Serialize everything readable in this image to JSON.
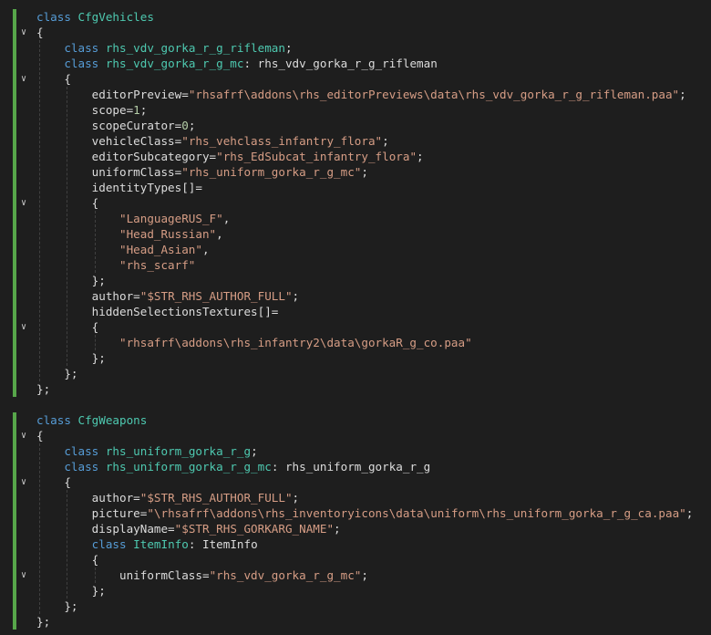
{
  "editor": {
    "language": "C++ (Arma config)",
    "lines": [
      [
        {
          "t": "kw",
          "v": "class "
        },
        {
          "t": "cls",
          "v": "CfgVehicles"
        }
      ],
      [
        {
          "t": "plain",
          "v": "{"
        }
      ],
      [
        {
          "t": "kw",
          "v": "    class "
        },
        {
          "t": "cls",
          "v": "rhs_vdv_gorka_r_g_rifleman"
        },
        {
          "t": "plain",
          "v": ";"
        }
      ],
      [
        {
          "t": "kw",
          "v": "    class "
        },
        {
          "t": "cls",
          "v": "rhs_vdv_gorka_r_g_mc"
        },
        {
          "t": "plain",
          "v": ": rhs_vdv_gorka_r_g_rifleman"
        }
      ],
      [
        {
          "t": "plain",
          "v": "    {"
        }
      ],
      [
        {
          "t": "plain",
          "v": "        editorPreview="
        },
        {
          "t": "str",
          "v": "\"rhsafrf\\addons\\rhs_editorPreviews\\data\\rhs_vdv_gorka_r_g_rifleman.paa\""
        },
        {
          "t": "plain",
          "v": ";"
        }
      ],
      [
        {
          "t": "plain",
          "v": "        scope="
        },
        {
          "t": "num",
          "v": "1"
        },
        {
          "t": "plain",
          "v": ";"
        }
      ],
      [
        {
          "t": "plain",
          "v": "        scopeCurator="
        },
        {
          "t": "num",
          "v": "0"
        },
        {
          "t": "plain",
          "v": ";"
        }
      ],
      [
        {
          "t": "plain",
          "v": "        vehicleClass="
        },
        {
          "t": "str",
          "v": "\"rhs_vehclass_infantry_flora\""
        },
        {
          "t": "plain",
          "v": ";"
        }
      ],
      [
        {
          "t": "plain",
          "v": "        editorSubcategory="
        },
        {
          "t": "str",
          "v": "\"rhs_EdSubcat_infantry_flora\""
        },
        {
          "t": "plain",
          "v": ";"
        }
      ],
      [
        {
          "t": "plain",
          "v": "        uniformClass="
        },
        {
          "t": "str",
          "v": "\"rhs_uniform_gorka_r_g_mc\""
        },
        {
          "t": "plain",
          "v": ";"
        }
      ],
      [
        {
          "t": "plain",
          "v": "        identityTypes[]="
        }
      ],
      [
        {
          "t": "plain",
          "v": "        {"
        }
      ],
      [
        {
          "t": "str",
          "v": "            \"LanguageRUS_F\""
        },
        {
          "t": "plain",
          "v": ","
        }
      ],
      [
        {
          "t": "str",
          "v": "            \"Head_Russian\""
        },
        {
          "t": "plain",
          "v": ","
        }
      ],
      [
        {
          "t": "str",
          "v": "            \"Head_Asian\""
        },
        {
          "t": "plain",
          "v": ","
        }
      ],
      [
        {
          "t": "str",
          "v": "            \"rhs_scarf\""
        }
      ],
      [
        {
          "t": "plain",
          "v": "        };"
        }
      ],
      [
        {
          "t": "plain",
          "v": "        author="
        },
        {
          "t": "str",
          "v": "\"$STR_RHS_AUTHOR_FULL\""
        },
        {
          "t": "plain",
          "v": ";"
        }
      ],
      [
        {
          "t": "plain",
          "v": "        hiddenSelectionsTextures[]="
        }
      ],
      [
        {
          "t": "plain",
          "v": "        {"
        }
      ],
      [
        {
          "t": "str",
          "v": "            \"rhsafrf\\addons\\rhs_infantry2\\data\\gorkaR_g_co.paa\""
        }
      ],
      [
        {
          "t": "plain",
          "v": "        };"
        }
      ],
      [
        {
          "t": "plain",
          "v": "    };"
        }
      ],
      [
        {
          "t": "plain",
          "v": "};"
        }
      ],
      [
        {
          "t": "plain",
          "v": ""
        }
      ],
      [
        {
          "t": "kw",
          "v": "class "
        },
        {
          "t": "cls",
          "v": "CfgWeapons"
        }
      ],
      [
        {
          "t": "plain",
          "v": "{"
        }
      ],
      [
        {
          "t": "kw",
          "v": "    class "
        },
        {
          "t": "cls",
          "v": "rhs_uniform_gorka_r_g"
        },
        {
          "t": "plain",
          "v": ";"
        }
      ],
      [
        {
          "t": "kw",
          "v": "    class "
        },
        {
          "t": "cls",
          "v": "rhs_uniform_gorka_r_g_mc"
        },
        {
          "t": "plain",
          "v": ": rhs_uniform_gorka_r_g"
        }
      ],
      [
        {
          "t": "plain",
          "v": "    {"
        }
      ],
      [
        {
          "t": "plain",
          "v": "        author="
        },
        {
          "t": "str",
          "v": "\"$STR_RHS_AUTHOR_FULL\""
        },
        {
          "t": "plain",
          "v": ";"
        }
      ],
      [
        {
          "t": "plain",
          "v": "        picture="
        },
        {
          "t": "str",
          "v": "\"\\rhsafrf\\addons\\rhs_inventoryicons\\data\\uniform\\rhs_uniform_gorka_r_g_ca.paa\""
        },
        {
          "t": "plain",
          "v": ";"
        }
      ],
      [
        {
          "t": "plain",
          "v": "        displayName="
        },
        {
          "t": "str",
          "v": "\"$STR_RHS_GORKARG_NAME\""
        },
        {
          "t": "plain",
          "v": ";"
        }
      ],
      [
        {
          "t": "kw",
          "v": "        class "
        },
        {
          "t": "cls",
          "v": "ItemInfo"
        },
        {
          "t": "plain",
          "v": ": ItemInfo"
        }
      ],
      [
        {
          "t": "plain",
          "v": "        {"
        }
      ],
      [
        {
          "t": "plain",
          "v": "            uniformClass="
        },
        {
          "t": "str",
          "v": "\"rhs_vdv_gorka_r_g_mc\""
        },
        {
          "t": "plain",
          "v": ";"
        }
      ],
      [
        {
          "t": "plain",
          "v": "        };"
        }
      ],
      [
        {
          "t": "plain",
          "v": "    };"
        }
      ],
      [
        {
          "t": "plain",
          "v": "};"
        }
      ]
    ],
    "fold_lines": [
      1,
      4,
      12,
      20,
      27,
      30,
      36
    ],
    "colors": {
      "background": "#1e1e1e",
      "keyword": "#569cd6",
      "class_name": "#4ec9b0",
      "string": "#d69d85",
      "number": "#b5cea8",
      "text": "#dcdcdc",
      "change_bar": "#57a64a"
    },
    "icons": {
      "fold": "chevron-down-icon"
    }
  }
}
